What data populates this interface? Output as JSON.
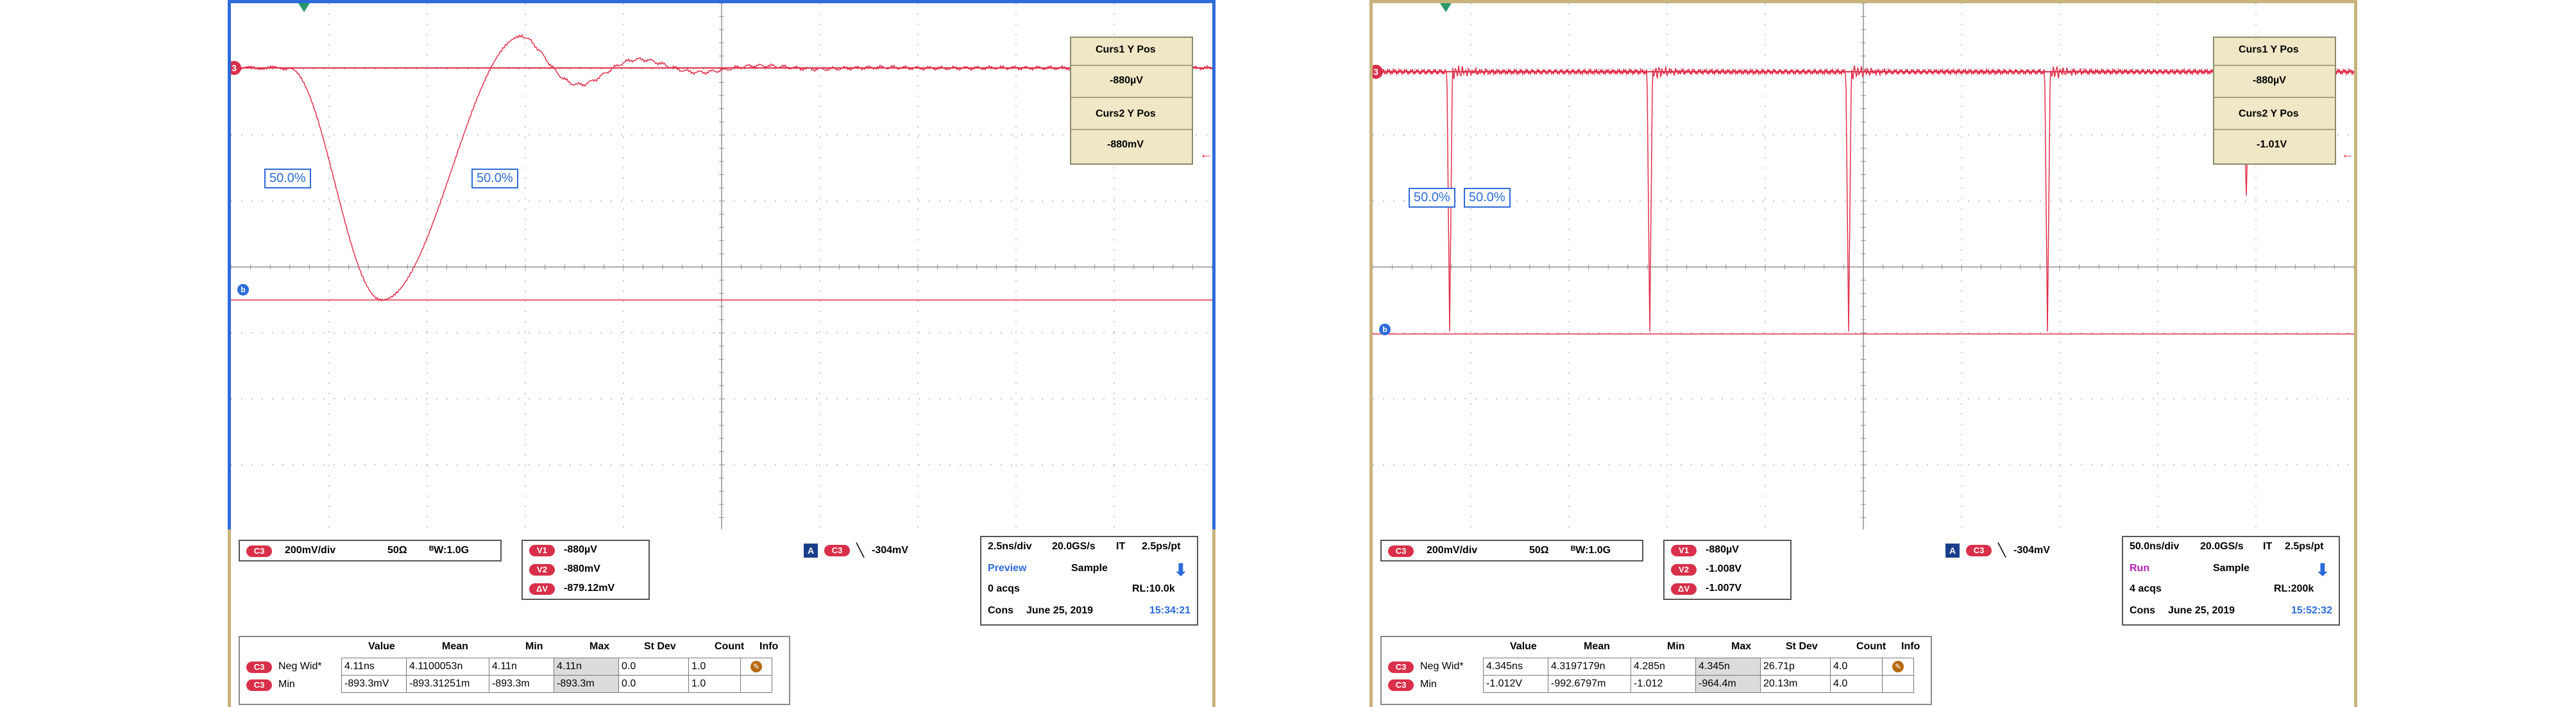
{
  "scope1": {
    "cursor_readout": {
      "curs1_label": "Curs1 Y Pos",
      "curs1_value": "-880µV",
      "curs2_label": "Curs2 Y Pos",
      "curs2_value": "-880mV"
    },
    "markers": {
      "ch": "3",
      "ref": "b",
      "pct_left": "50.0%",
      "pct_right": "50.0%"
    },
    "channel": {
      "badge": "C3",
      "scale": "200mV/div",
      "impedance": "50Ω",
      "bw": "ᴮW:1.0G"
    },
    "cursors": [
      {
        "badge": "V1",
        "value": "-880µV"
      },
      {
        "badge": "V2",
        "value": "-880mV"
      },
      {
        "badge": "ΔV",
        "value": "-879.12mV"
      }
    ],
    "trigger": {
      "a": "A",
      "badge": "C3",
      "level": "-304mV"
    },
    "timebase": {
      "tdiv": "2.5ns/div",
      "rate": "20.0GS/s",
      "mode": "IT",
      "res": "2.5ps/pt",
      "state": "Preview",
      "acq_mode": "Sample",
      "acqs": "0 acqs",
      "rl": "RL:10.0k",
      "cons": "Cons",
      "date": "June 25, 2019",
      "time": "15:34:21"
    },
    "meas_headers": [
      "Value",
      "Mean",
      "Min",
      "Max",
      "St Dev",
      "Count",
      "Info"
    ],
    "meas_rows": [
      {
        "badge": "C3",
        "name": "Neg Wid*",
        "cells": [
          "4.11ns",
          "4.1100053n",
          "4.11n",
          "4.11n",
          "0.0",
          "1.0"
        ]
      },
      {
        "badge": "C3",
        "name": "Min",
        "cells": [
          "-893.3mV",
          "-893.31251m",
          "-893.3m",
          "-893.3m",
          "0.0",
          "1.0"
        ]
      }
    ]
  },
  "scope2": {
    "cursor_readout": {
      "curs1_label": "Curs1 Y Pos",
      "curs1_value": "-880µV",
      "curs2_label": "Curs2 Y Pos",
      "curs2_value": "-1.01V"
    },
    "markers": {
      "ch": "3",
      "ref": "b",
      "pct_left": "50.0%",
      "pct_right": "50.0%"
    },
    "channel": {
      "badge": "C3",
      "scale": "200mV/div",
      "impedance": "50Ω",
      "bw": "ᴮW:1.0G"
    },
    "cursors": [
      {
        "badge": "V1",
        "value": "-880µV"
      },
      {
        "badge": "V2",
        "value": "-1.008V"
      },
      {
        "badge": "ΔV",
        "value": "-1.007V"
      }
    ],
    "trigger": {
      "a": "A",
      "badge": "C3",
      "level": "-304mV"
    },
    "timebase": {
      "tdiv": "50.0ns/div",
      "rate": "20.0GS/s",
      "mode": "IT",
      "res": "2.5ps/pt",
      "state": "Run",
      "acq_mode": "Sample",
      "acqs": "4 acqs",
      "rl": "RL:200k",
      "cons": "Cons",
      "date": "June 25, 2019",
      "time": "15:52:32"
    },
    "meas_headers": [
      "Value",
      "Mean",
      "Min",
      "Max",
      "St Dev",
      "Count",
      "Info"
    ],
    "meas_rows": [
      {
        "badge": "C3",
        "name": "Neg Wid*",
        "cells": [
          "4.345ns",
          "4.3197179n",
          "4.285n",
          "4.345n",
          "26.71p",
          "4.0"
        ]
      },
      {
        "badge": "C3",
        "name": "Min",
        "cells": [
          "-1.012V",
          "-992.6797m",
          "-1.012",
          "-964.4m",
          "20.13m",
          "4.0"
        ]
      }
    ]
  },
  "colors": {
    "trace": "#e0304c",
    "grid": "#909090",
    "frame": "#2d6bd8",
    "panel": "#c7b37c",
    "cursor_box": "#efe7c5"
  }
}
